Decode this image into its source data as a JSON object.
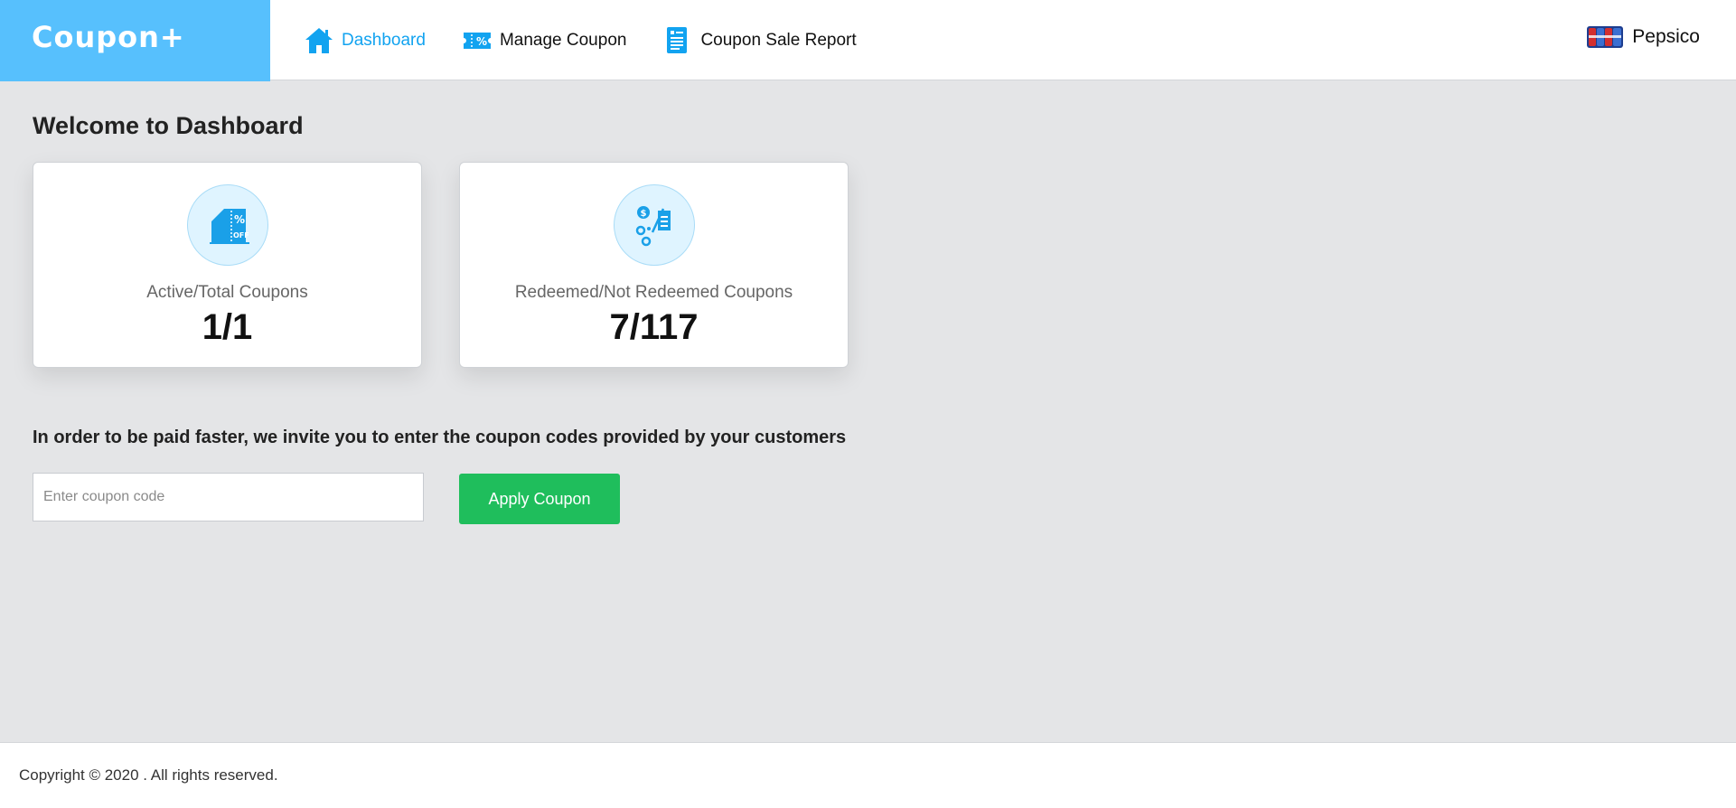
{
  "brand": {
    "name": "Coupon+"
  },
  "nav": {
    "items": [
      {
        "label": "Dashboard",
        "icon": "home-icon",
        "active": true
      },
      {
        "label": "Manage Coupon",
        "icon": "coupon-ticket-icon",
        "active": false
      },
      {
        "label": "Coupon Sale Report",
        "icon": "report-document-icon",
        "active": false
      }
    ]
  },
  "user": {
    "name": "Pepsico",
    "logo": "pepsico-logo"
  },
  "page": {
    "title": "Welcome to Dashboard"
  },
  "cards": [
    {
      "label": "Active/Total Coupons",
      "value": "1/1",
      "icon": "coupon-percent-off-icon"
    },
    {
      "label": "Redeemed/Not Redeemed Coupons",
      "value": "7/117",
      "icon": "redeem-receipt-icon"
    }
  ],
  "redeem": {
    "instruction": "In order to be paid faster, we invite you to enter the coupon codes provided by your customers",
    "input_value": "",
    "input_placeholder": "Enter coupon code",
    "button_label": "Apply Coupon"
  },
  "footer": {
    "copyright": "Copyright © 2020 . All rights reserved."
  },
  "colors": {
    "brand": "#57c0fd",
    "accent": "#12a3f0",
    "success": "#1fbe5c",
    "background": "#e4e5e7"
  }
}
